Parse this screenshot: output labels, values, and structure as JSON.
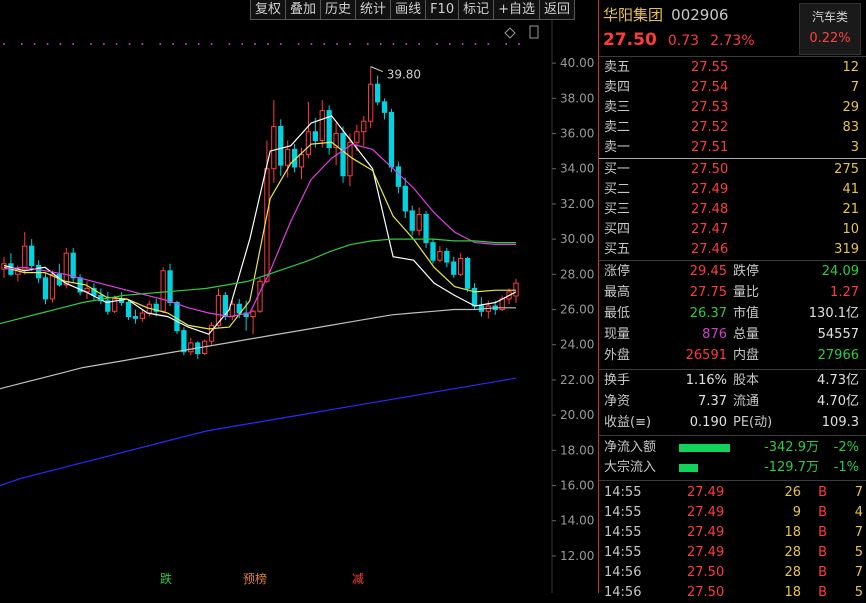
{
  "toolbar": [
    "复权",
    "叠加",
    "历史",
    "统计",
    "画线",
    "F10",
    "标记",
    "+自选",
    "返回"
  ],
  "stock": {
    "name": "华阳集团",
    "code": "002906",
    "price": "27.50",
    "change": "0.73",
    "change_pct": "2.73%"
  },
  "sector": {
    "name": "汽车类",
    "pct": "0.22%"
  },
  "ask": [
    {
      "label": "卖五",
      "price": "27.55",
      "vol": "12"
    },
    {
      "label": "卖四",
      "price": "27.54",
      "vol": "7"
    },
    {
      "label": "卖三",
      "price": "27.53",
      "vol": "29"
    },
    {
      "label": "卖二",
      "price": "27.52",
      "vol": "83"
    },
    {
      "label": "卖一",
      "price": "27.51",
      "vol": "3"
    }
  ],
  "bid": [
    {
      "label": "买一",
      "price": "27.50",
      "vol": "275"
    },
    {
      "label": "买二",
      "price": "27.49",
      "vol": "41"
    },
    {
      "label": "买三",
      "price": "27.48",
      "vol": "21"
    },
    {
      "label": "买四",
      "price": "27.47",
      "vol": "10"
    },
    {
      "label": "买五",
      "price": "27.46",
      "vol": "319"
    }
  ],
  "stats": {
    "limit_up_label": "涨停",
    "limit_up": "29.45",
    "limit_down_label": "跌停",
    "limit_down": "24.09",
    "high_label": "最高",
    "high": "27.75",
    "vol_ratio_label": "量比",
    "vol_ratio": "1.27",
    "low_label": "最低",
    "low": "26.37",
    "mkt_cap_label": "市值",
    "mkt_cap": "130.1亿",
    "cur_vol_label": "现量",
    "cur_vol": "876",
    "total_vol_label": "总量",
    "total_vol": "54557",
    "outer_label": "外盘",
    "outer": "26591",
    "inner_label": "内盘",
    "inner": "27966"
  },
  "fundamentals": {
    "turnover_label": "换手",
    "turnover": "1.16%",
    "share_cap_label": "股本",
    "share_cap": "4.73亿",
    "nav_label": "净资",
    "nav": "7.37",
    "float_label": "流通",
    "float_cap": "4.70亿",
    "eps_label": "收益(≡)",
    "eps": "0.190",
    "pe_label": "PE(动)",
    "pe": "109.3"
  },
  "flows": [
    {
      "label": "净流入额",
      "value": "-342.9万",
      "pct": "-2%",
      "bar_fraction": 0.85
    },
    {
      "label": "大宗流入",
      "value": "-129.7万",
      "pct": "-1%",
      "bar_fraction": 0.32
    }
  ],
  "ticks": [
    {
      "time": "14:55",
      "price": "27.49",
      "vol": "26",
      "side": "B",
      "n": "7"
    },
    {
      "time": "14:55",
      "price": "27.49",
      "vol": "9",
      "side": "B",
      "n": "4"
    },
    {
      "time": "14:55",
      "price": "27.49",
      "vol": "18",
      "side": "B",
      "n": "7"
    },
    {
      "time": "14:55",
      "price": "27.49",
      "vol": "28",
      "side": "B",
      "n": "5"
    },
    {
      "time": "14:56",
      "price": "27.50",
      "vol": "28",
      "side": "B",
      "n": "7"
    },
    {
      "time": "14:56",
      "price": "27.50",
      "vol": "18",
      "side": "B",
      "n": "5"
    }
  ],
  "chart_data": {
    "type": "candlestick",
    "yticks": [
      "40.00",
      "38.00",
      "36.00",
      "34.00",
      "32.00",
      "30.00",
      "28.00",
      "26.00",
      "24.00",
      "22.00",
      "20.00",
      "18.00",
      "16.00",
      "14.00",
      "12.00"
    ],
    "ylim": [
      11.2,
      41.2
    ],
    "high_marker": "39.80",
    "events": [
      "跌",
      "预榜",
      "减"
    ],
    "colors": {
      "up": "#ff3b3b",
      "down": "#00d2e0",
      "ma5": "#ffffff",
      "ma10": "#e8e84a",
      "ma20": "#e040e0",
      "ma60": "#2ecc40",
      "ma120": "#c0c0c0",
      "ma250": "#2a2aff"
    },
    "candles": [
      [
        28.3,
        29.0,
        27.8,
        28.6
      ],
      [
        28.6,
        29.2,
        27.9,
        28.0
      ],
      [
        28.0,
        28.5,
        27.6,
        28.3
      ],
      [
        28.3,
        30.4,
        28.0,
        29.6
      ],
      [
        29.6,
        30.0,
        28.2,
        28.5
      ],
      [
        28.5,
        28.8,
        27.5,
        27.8
      ],
      [
        27.8,
        28.1,
        26.3,
        26.6
      ],
      [
        26.6,
        28.2,
        26.4,
        28.0
      ],
      [
        28.0,
        28.6,
        27.3,
        27.4
      ],
      [
        27.4,
        29.5,
        27.2,
        29.2
      ],
      [
        29.2,
        29.5,
        27.5,
        27.8
      ],
      [
        27.8,
        28.0,
        26.8,
        27.0
      ],
      [
        27.0,
        27.6,
        26.6,
        27.2
      ],
      [
        27.2,
        27.5,
        26.5,
        26.8
      ],
      [
        26.8,
        27.2,
        26.3,
        26.5
      ],
      [
        26.5,
        27.0,
        25.7,
        25.9
      ],
      [
        25.9,
        26.8,
        25.8,
        26.6
      ],
      [
        26.6,
        27.0,
        26.2,
        26.4
      ],
      [
        26.4,
        26.6,
        25.4,
        25.6
      ],
      [
        25.6,
        26.0,
        25.2,
        25.5
      ],
      [
        25.5,
        26.0,
        25.3,
        25.8
      ],
      [
        25.8,
        26.5,
        25.6,
        26.3
      ],
      [
        26.3,
        26.6,
        25.6,
        25.9
      ],
      [
        25.9,
        28.4,
        25.8,
        28.2
      ],
      [
        28.2,
        28.6,
        26.2,
        26.4
      ],
      [
        26.4,
        26.5,
        24.6,
        24.8
      ],
      [
        24.8,
        25.0,
        23.4,
        23.6
      ],
      [
        23.6,
        24.4,
        23.4,
        24.1
      ],
      [
        24.1,
        24.2,
        23.2,
        23.5
      ],
      [
        23.5,
        24.3,
        23.4,
        24.2
      ],
      [
        24.2,
        25.3,
        24.0,
        25.1
      ],
      [
        25.1,
        27.2,
        25.0,
        26.8
      ],
      [
        26.8,
        27.0,
        25.4,
        25.6
      ],
      [
        25.6,
        26.5,
        25.4,
        26.3
      ],
      [
        26.3,
        26.6,
        25.5,
        25.8
      ],
      [
        25.8,
        26.5,
        24.8,
        25.6
      ],
      [
        25.6,
        26.0,
        24.6,
        25.9
      ],
      [
        25.9,
        27.8,
        25.8,
        27.6
      ],
      [
        27.6,
        35.6,
        27.5,
        34.0
      ],
      [
        34.0,
        37.9,
        33.2,
        36.4
      ],
      [
        36.4,
        36.8,
        33.6,
        34.2
      ],
      [
        34.2,
        35.6,
        33.5,
        35.1
      ],
      [
        35.1,
        35.4,
        33.8,
        34.1
      ],
      [
        34.1,
        35.2,
        33.4,
        34.8
      ],
      [
        34.8,
        37.8,
        34.6,
        36.1
      ],
      [
        36.1,
        36.9,
        35.2,
        35.6
      ],
      [
        35.6,
        37.9,
        35.2,
        37.3
      ],
      [
        37.3,
        37.6,
        34.8,
        35.2
      ],
      [
        35.2,
        36.6,
        34.2,
        36.0
      ],
      [
        36.0,
        36.4,
        33.2,
        33.6
      ],
      [
        33.6,
        36.0,
        33.0,
        35.5
      ],
      [
        35.5,
        36.5,
        35.0,
        36.1
      ],
      [
        36.1,
        37.0,
        35.3,
        36.7
      ],
      [
        36.7,
        39.8,
        36.3,
        38.8
      ],
      [
        38.8,
        39.3,
        37.6,
        37.8
      ],
      [
        37.8,
        38.0,
        36.8,
        37.2
      ],
      [
        37.2,
        37.4,
        33.8,
        34.1
      ],
      [
        34.1,
        34.4,
        32.6,
        33.0
      ],
      [
        33.0,
        33.5,
        31.2,
        31.6
      ],
      [
        31.6,
        31.9,
        30.2,
        30.5
      ],
      [
        30.5,
        31.8,
        30.2,
        31.4
      ],
      [
        31.4,
        31.6,
        29.5,
        29.8
      ],
      [
        29.8,
        30.0,
        28.6,
        28.8
      ],
      [
        28.8,
        29.6,
        28.7,
        29.3
      ],
      [
        29.3,
        29.5,
        28.4,
        28.7
      ],
      [
        28.7,
        29.0,
        27.8,
        28.0
      ],
      [
        28.0,
        29.2,
        27.9,
        28.9
      ],
      [
        28.9,
        29.0,
        27.0,
        27.2
      ],
      [
        27.2,
        27.5,
        26.0,
        26.2
      ],
      [
        26.2,
        26.7,
        25.6,
        25.9
      ],
      [
        25.9,
        26.5,
        25.5,
        26.2
      ],
      [
        26.2,
        26.5,
        25.7,
        26.0
      ],
      [
        26.0,
        26.8,
        25.9,
        26.6
      ],
      [
        26.6,
        27.2,
        26.3,
        27.0
      ],
      [
        26.77,
        27.75,
        26.37,
        27.5
      ]
    ],
    "ma": {
      "ma5": [
        [
          28.5,
          28.2
        ],
        [
          28.4,
          27.5
        ],
        [
          27.0,
          26.4
        ],
        [
          26.6,
          25.8
        ],
        [
          25.6,
          25.0
        ],
        [
          24.6,
          26.0
        ],
        [
          30.0,
          35.0
        ],
        [
          35.3,
          36.6
        ],
        [
          37.0,
          35.5
        ],
        [
          34.0,
          29.0
        ],
        [
          28.8,
          27.5
        ],
        [
          26.8,
          26.2
        ],
        [
          26.4,
          27.0
        ]
      ],
      "ma10": [
        [
          28.4,
          28.1
        ],
        [
          28.1,
          27.6
        ],
        [
          27.4,
          26.7
        ],
        [
          26.6,
          26.1
        ],
        [
          25.8,
          25.1
        ],
        [
          24.9,
          25.0
        ],
        [
          26.5,
          32.3
        ],
        [
          34.3,
          35.4
        ],
        [
          35.5,
          34.6
        ],
        [
          33.9,
          31.3
        ],
        [
          30.0,
          28.4
        ],
        [
          27.3,
          27.0
        ],
        [
          27.1,
          27.1
        ]
      ],
      "ma20": [
        [
          28.3,
          28.4
        ],
        [
          28.2,
          28.0
        ],
        [
          27.7,
          27.4
        ],
        [
          27.1,
          26.8
        ],
        [
          26.5,
          26.1
        ],
        [
          25.8,
          25.6
        ],
        [
          25.8,
          28.2
        ],
        [
          31.0,
          33.4
        ],
        [
          34.6,
          35.4
        ],
        [
          35.1,
          34.0
        ],
        [
          32.9,
          31.5
        ],
        [
          30.4,
          29.8
        ],
        [
          29.7,
          29.7
        ]
      ],
      "ma60": [
        [
          25.2,
          25.5
        ],
        [
          25.8,
          26.1
        ],
        [
          26.4,
          26.6
        ],
        [
          26.8,
          26.9
        ],
        [
          27.0,
          27.1
        ],
        [
          27.2,
          27.4
        ],
        [
          27.6,
          28.0
        ],
        [
          28.4,
          28.8
        ],
        [
          29.3,
          29.7
        ],
        [
          29.9,
          30.0
        ],
        [
          30.0,
          30.0
        ],
        [
          29.9,
          29.9
        ],
        [
          29.8,
          29.8
        ]
      ],
      "ma120": [
        [
          21.5,
          21.8
        ],
        [
          22.1,
          22.4
        ],
        [
          22.7,
          22.9
        ],
        [
          23.1,
          23.3
        ],
        [
          23.5,
          23.7
        ],
        [
          23.9,
          24.1
        ],
        [
          24.3,
          24.5
        ],
        [
          24.7,
          24.9
        ],
        [
          25.1,
          25.3
        ],
        [
          25.5,
          25.7
        ],
        [
          25.8,
          25.9
        ],
        [
          26.0,
          26.0
        ],
        [
          26.1,
          26.1
        ]
      ],
      "ma250": [
        [
          16.0,
          16.4
        ],
        [
          16.7,
          17.0
        ],
        [
          17.3,
          17.6
        ],
        [
          17.9,
          18.2
        ],
        [
          18.5,
          18.8
        ],
        [
          19.1,
          19.3
        ],
        [
          19.5,
          19.7
        ],
        [
          19.9,
          20.1
        ],
        [
          20.3,
          20.5
        ],
        [
          20.7,
          20.9
        ],
        [
          21.1,
          21.3
        ],
        [
          21.5,
          21.7
        ],
        [
          21.9,
          22.1
        ]
      ]
    }
  }
}
